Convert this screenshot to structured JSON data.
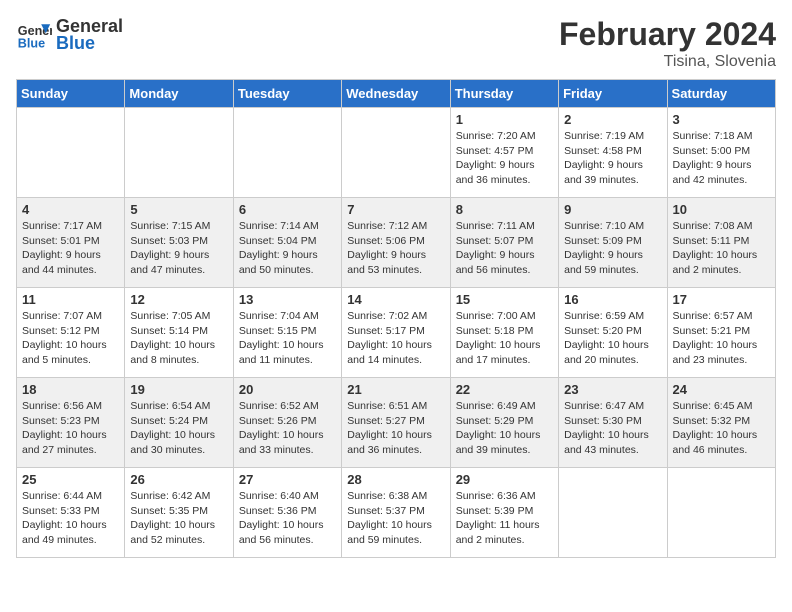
{
  "header": {
    "logo_general": "General",
    "logo_blue": "Blue",
    "month_year": "February 2024",
    "location": "Tisina, Slovenia"
  },
  "weekdays": [
    "Sunday",
    "Monday",
    "Tuesday",
    "Wednesday",
    "Thursday",
    "Friday",
    "Saturday"
  ],
  "weeks": [
    [
      {
        "day": "",
        "info": ""
      },
      {
        "day": "",
        "info": ""
      },
      {
        "day": "",
        "info": ""
      },
      {
        "day": "",
        "info": ""
      },
      {
        "day": "1",
        "info": "Sunrise: 7:20 AM\nSunset: 4:57 PM\nDaylight: 9 hours\nand 36 minutes."
      },
      {
        "day": "2",
        "info": "Sunrise: 7:19 AM\nSunset: 4:58 PM\nDaylight: 9 hours\nand 39 minutes."
      },
      {
        "day": "3",
        "info": "Sunrise: 7:18 AM\nSunset: 5:00 PM\nDaylight: 9 hours\nand 42 minutes."
      }
    ],
    [
      {
        "day": "4",
        "info": "Sunrise: 7:17 AM\nSunset: 5:01 PM\nDaylight: 9 hours\nand 44 minutes."
      },
      {
        "day": "5",
        "info": "Sunrise: 7:15 AM\nSunset: 5:03 PM\nDaylight: 9 hours\nand 47 minutes."
      },
      {
        "day": "6",
        "info": "Sunrise: 7:14 AM\nSunset: 5:04 PM\nDaylight: 9 hours\nand 50 minutes."
      },
      {
        "day": "7",
        "info": "Sunrise: 7:12 AM\nSunset: 5:06 PM\nDaylight: 9 hours\nand 53 minutes."
      },
      {
        "day": "8",
        "info": "Sunrise: 7:11 AM\nSunset: 5:07 PM\nDaylight: 9 hours\nand 56 minutes."
      },
      {
        "day": "9",
        "info": "Sunrise: 7:10 AM\nSunset: 5:09 PM\nDaylight: 9 hours\nand 59 minutes."
      },
      {
        "day": "10",
        "info": "Sunrise: 7:08 AM\nSunset: 5:11 PM\nDaylight: 10 hours\nand 2 minutes."
      }
    ],
    [
      {
        "day": "11",
        "info": "Sunrise: 7:07 AM\nSunset: 5:12 PM\nDaylight: 10 hours\nand 5 minutes."
      },
      {
        "day": "12",
        "info": "Sunrise: 7:05 AM\nSunset: 5:14 PM\nDaylight: 10 hours\nand 8 minutes."
      },
      {
        "day": "13",
        "info": "Sunrise: 7:04 AM\nSunset: 5:15 PM\nDaylight: 10 hours\nand 11 minutes."
      },
      {
        "day": "14",
        "info": "Sunrise: 7:02 AM\nSunset: 5:17 PM\nDaylight: 10 hours\nand 14 minutes."
      },
      {
        "day": "15",
        "info": "Sunrise: 7:00 AM\nSunset: 5:18 PM\nDaylight: 10 hours\nand 17 minutes."
      },
      {
        "day": "16",
        "info": "Sunrise: 6:59 AM\nSunset: 5:20 PM\nDaylight: 10 hours\nand 20 minutes."
      },
      {
        "day": "17",
        "info": "Sunrise: 6:57 AM\nSunset: 5:21 PM\nDaylight: 10 hours\nand 23 minutes."
      }
    ],
    [
      {
        "day": "18",
        "info": "Sunrise: 6:56 AM\nSunset: 5:23 PM\nDaylight: 10 hours\nand 27 minutes."
      },
      {
        "day": "19",
        "info": "Sunrise: 6:54 AM\nSunset: 5:24 PM\nDaylight: 10 hours\nand 30 minutes."
      },
      {
        "day": "20",
        "info": "Sunrise: 6:52 AM\nSunset: 5:26 PM\nDaylight: 10 hours\nand 33 minutes."
      },
      {
        "day": "21",
        "info": "Sunrise: 6:51 AM\nSunset: 5:27 PM\nDaylight: 10 hours\nand 36 minutes."
      },
      {
        "day": "22",
        "info": "Sunrise: 6:49 AM\nSunset: 5:29 PM\nDaylight: 10 hours\nand 39 minutes."
      },
      {
        "day": "23",
        "info": "Sunrise: 6:47 AM\nSunset: 5:30 PM\nDaylight: 10 hours\nand 43 minutes."
      },
      {
        "day": "24",
        "info": "Sunrise: 6:45 AM\nSunset: 5:32 PM\nDaylight: 10 hours\nand 46 minutes."
      }
    ],
    [
      {
        "day": "25",
        "info": "Sunrise: 6:44 AM\nSunset: 5:33 PM\nDaylight: 10 hours\nand 49 minutes."
      },
      {
        "day": "26",
        "info": "Sunrise: 6:42 AM\nSunset: 5:35 PM\nDaylight: 10 hours\nand 52 minutes."
      },
      {
        "day": "27",
        "info": "Sunrise: 6:40 AM\nSunset: 5:36 PM\nDaylight: 10 hours\nand 56 minutes."
      },
      {
        "day": "28",
        "info": "Sunrise: 6:38 AM\nSunset: 5:37 PM\nDaylight: 10 hours\nand 59 minutes."
      },
      {
        "day": "29",
        "info": "Sunrise: 6:36 AM\nSunset: 5:39 PM\nDaylight: 11 hours\nand 2 minutes."
      },
      {
        "day": "",
        "info": ""
      },
      {
        "day": "",
        "info": ""
      }
    ]
  ]
}
